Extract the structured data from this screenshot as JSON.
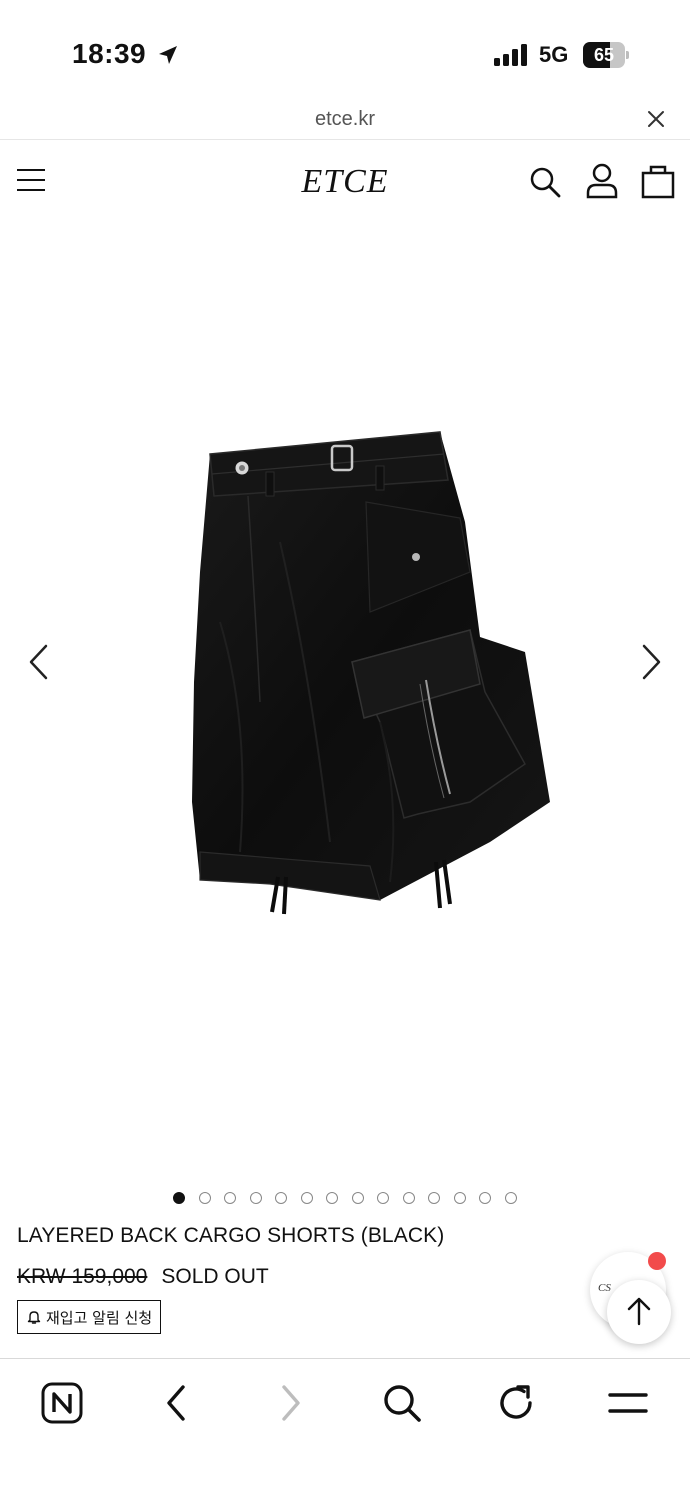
{
  "status_bar": {
    "time": "18:39",
    "network": "5G",
    "battery_level": "65",
    "battery_fraction": 0.65,
    "icons": [
      "location-arrow-icon",
      "signal-icon",
      "battery-icon"
    ]
  },
  "browser": {
    "url": "etce.kr",
    "toolbar_icons": [
      "naver-n-icon",
      "back-icon",
      "forward-icon",
      "search-icon",
      "reload-icon",
      "menu-icon"
    ]
  },
  "header": {
    "logo": "ETCE",
    "icons": [
      "hamburger-menu-icon",
      "search-icon",
      "account-icon",
      "shopping-bag-icon"
    ]
  },
  "gallery": {
    "image_count": 14,
    "active_index": 0,
    "image_subject": "black cargo shorts",
    "icons": [
      "chevron-left-icon",
      "chevron-right-icon"
    ]
  },
  "product": {
    "name": "LAYERED BACK CARGO SHORTS (BLACK)",
    "price": "KRW 159,000",
    "status": "SOLD OUT",
    "restock_label": "재입고 알림 신청"
  },
  "floating": {
    "cs_label": "CS",
    "notification_color": "#f24b4b"
  }
}
